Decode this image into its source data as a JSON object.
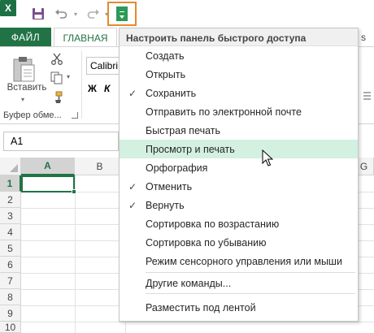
{
  "qat": {
    "excel_logo": "X",
    "undo_arrow": "▾",
    "redo_arrow": "▾"
  },
  "tabs": {
    "file": "ФАЙЛ",
    "home": "ГЛАВНАЯ",
    "more": "s"
  },
  "ribbon": {
    "paste_label": "Вставить",
    "paste_arrow": "▾",
    "copy_arrow": "▾",
    "clipboard_group": "Буфер обме...",
    "font_name": "Calibri",
    "bold": "Ж",
    "italic": "К"
  },
  "formula": {
    "name_box": "A1"
  },
  "grid": {
    "columns": [
      "A",
      "B",
      "G"
    ],
    "rows": [
      "1",
      "2",
      "3",
      "4",
      "5",
      "6",
      "7",
      "8",
      "9",
      "10"
    ]
  },
  "menu": {
    "title": "Настроить панель быстрого доступа",
    "check_mark": "✓",
    "items": [
      {
        "label": "Создать",
        "checked": false
      },
      {
        "label": "Открыть",
        "checked": false
      },
      {
        "label": "Сохранить",
        "checked": true
      },
      {
        "label": "Отправить по электронной почте",
        "checked": false
      },
      {
        "label": "Быстрая печать",
        "checked": false
      },
      {
        "label": "Просмотр и печать",
        "checked": false
      },
      {
        "label": "Орфография",
        "checked": false
      },
      {
        "label": "Отменить",
        "checked": true
      },
      {
        "label": "Вернуть",
        "checked": true
      },
      {
        "label": "Сортировка по возрастанию",
        "checked": false
      },
      {
        "label": "Сортировка по убыванию",
        "checked": false
      },
      {
        "label": "Режим сенсорного управления или мыши",
        "checked": false
      }
    ],
    "more_commands": "Другие команды...",
    "show_below": "Разместить под лентой"
  },
  "colors": {
    "accent": "#217346",
    "highlight": "#e58a2e",
    "hover": "#d3f0e0"
  }
}
